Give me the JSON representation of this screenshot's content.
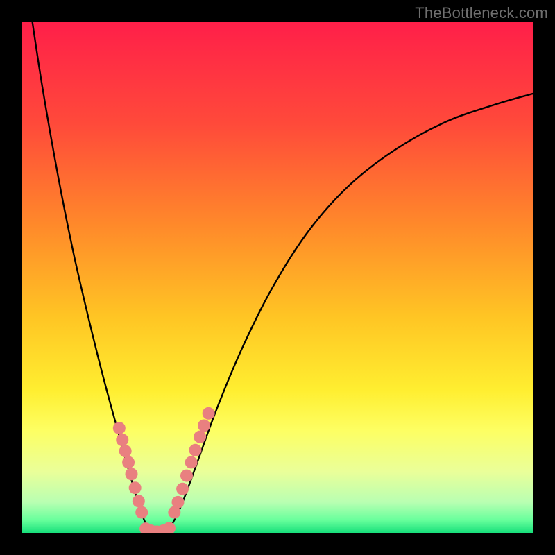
{
  "watermark": "TheBottleneck.com",
  "chart_data": {
    "type": "line",
    "title": "",
    "xlabel": "",
    "ylabel": "",
    "xlim": [
      0,
      100
    ],
    "ylim": [
      0,
      100
    ],
    "gradient_stops": [
      {
        "offset": 0.0,
        "color": "#ff1f49"
      },
      {
        "offset": 0.2,
        "color": "#ff4a3a"
      },
      {
        "offset": 0.4,
        "color": "#ff8a2a"
      },
      {
        "offset": 0.58,
        "color": "#ffc624"
      },
      {
        "offset": 0.72,
        "color": "#ffee30"
      },
      {
        "offset": 0.8,
        "color": "#fdff63"
      },
      {
        "offset": 0.88,
        "color": "#eaff99"
      },
      {
        "offset": 0.94,
        "color": "#b9ffb2"
      },
      {
        "offset": 0.975,
        "color": "#68ff9c"
      },
      {
        "offset": 1.0,
        "color": "#18e07b"
      }
    ],
    "curve_points": [
      {
        "x": 2.0,
        "y": 100.0
      },
      {
        "x": 4.0,
        "y": 87.0
      },
      {
        "x": 7.0,
        "y": 70.0
      },
      {
        "x": 10.0,
        "y": 55.0
      },
      {
        "x": 13.0,
        "y": 42.0
      },
      {
        "x": 16.0,
        "y": 30.0
      },
      {
        "x": 19.0,
        "y": 19.0
      },
      {
        "x": 21.5,
        "y": 10.0
      },
      {
        "x": 23.5,
        "y": 3.5
      },
      {
        "x": 25.0,
        "y": 0.5
      },
      {
        "x": 26.5,
        "y": 0.0
      },
      {
        "x": 28.5,
        "y": 0.5
      },
      {
        "x": 31.0,
        "y": 5.0
      },
      {
        "x": 34.0,
        "y": 13.0
      },
      {
        "x": 38.0,
        "y": 24.0
      },
      {
        "x": 43.0,
        "y": 36.0
      },
      {
        "x": 49.0,
        "y": 48.0
      },
      {
        "x": 56.0,
        "y": 59.0
      },
      {
        "x": 64.0,
        "y": 68.0
      },
      {
        "x": 73.0,
        "y": 75.0
      },
      {
        "x": 83.0,
        "y": 80.5
      },
      {
        "x": 93.0,
        "y": 84.0
      },
      {
        "x": 100.0,
        "y": 86.0
      }
    ],
    "marker_clusters": [
      {
        "cluster": "left-branch",
        "points": [
          {
            "x": 19.0,
            "y": 20.5
          },
          {
            "x": 19.6,
            "y": 18.2
          },
          {
            "x": 20.2,
            "y": 16.0
          },
          {
            "x": 20.8,
            "y": 13.8
          },
          {
            "x": 21.4,
            "y": 11.5
          },
          {
            "x": 22.1,
            "y": 8.8
          },
          {
            "x": 22.8,
            "y": 6.2
          },
          {
            "x": 23.4,
            "y": 4.0
          }
        ]
      },
      {
        "cluster": "right-branch",
        "points": [
          {
            "x": 29.8,
            "y": 4.0
          },
          {
            "x": 30.5,
            "y": 6.0
          },
          {
            "x": 31.4,
            "y": 8.6
          },
          {
            "x": 32.2,
            "y": 11.2
          },
          {
            "x": 33.1,
            "y": 13.8
          },
          {
            "x": 33.9,
            "y": 16.2
          },
          {
            "x": 34.8,
            "y": 18.8
          },
          {
            "x": 35.6,
            "y": 21.0
          },
          {
            "x": 36.5,
            "y": 23.4
          }
        ]
      },
      {
        "cluster": "bottom",
        "points": [
          {
            "x": 24.2,
            "y": 0.8
          },
          {
            "x": 25.2,
            "y": 0.4
          },
          {
            "x": 26.4,
            "y": 0.2
          },
          {
            "x": 27.6,
            "y": 0.4
          },
          {
            "x": 28.8,
            "y": 0.9
          }
        ]
      }
    ],
    "marker_style": {
      "color": "#e98080",
      "radius": 9
    }
  }
}
